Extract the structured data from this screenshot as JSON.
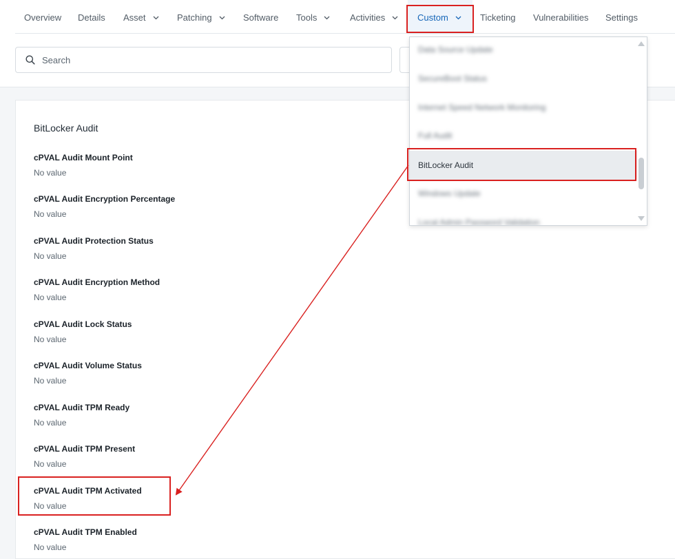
{
  "nav": {
    "tabs": [
      {
        "label": "Overview"
      },
      {
        "label": "Details"
      },
      {
        "label": "Asset"
      },
      {
        "label": "Patching"
      },
      {
        "label": "Software"
      },
      {
        "label": "Tools"
      },
      {
        "label": "Activities"
      },
      {
        "label": "Custom"
      },
      {
        "label": "Ticketing"
      },
      {
        "label": "Vulnerabilities"
      },
      {
        "label": "Settings"
      }
    ],
    "active_tab": "Custom"
  },
  "search": {
    "placeholder": "Search",
    "value": ""
  },
  "custom_menu": {
    "items": [
      {
        "label": "Data Source Update",
        "blurred": true
      },
      {
        "label": "SecureBoot Status",
        "blurred": true
      },
      {
        "label": "Internet Speed Network Monitoring",
        "blurred": true
      },
      {
        "label": "Full Audit",
        "blurred": true
      },
      {
        "label": "BitLocker Audit",
        "blurred": false,
        "selected": true
      },
      {
        "label": "Windows Update",
        "blurred": true
      },
      {
        "label": "Local Admin Password Validation",
        "blurred": true
      }
    ]
  },
  "section": {
    "title": "BitLocker Audit",
    "fields": [
      {
        "label": "cPVAL Audit Mount Point",
        "value": "No value"
      },
      {
        "label": "cPVAL Audit Encryption Percentage",
        "value": "No value"
      },
      {
        "label": "cPVAL Audit Protection Status",
        "value": "No value"
      },
      {
        "label": "cPVAL Audit Encryption Method",
        "value": "No value"
      },
      {
        "label": "cPVAL Audit Lock Status",
        "value": "No value"
      },
      {
        "label": "cPVAL Audit Volume Status",
        "value": "No value"
      },
      {
        "label": "cPVAL Audit TPM Ready",
        "value": "No value"
      },
      {
        "label": "cPVAL Audit TPM Present",
        "value": "No value"
      },
      {
        "label": "cPVAL Audit TPM Activated",
        "value": "No value"
      },
      {
        "label": "cPVAL Audit TPM Enabled",
        "value": "No value"
      }
    ]
  },
  "colors": {
    "accent": "#1666b8",
    "annotation": "#d9201f"
  }
}
